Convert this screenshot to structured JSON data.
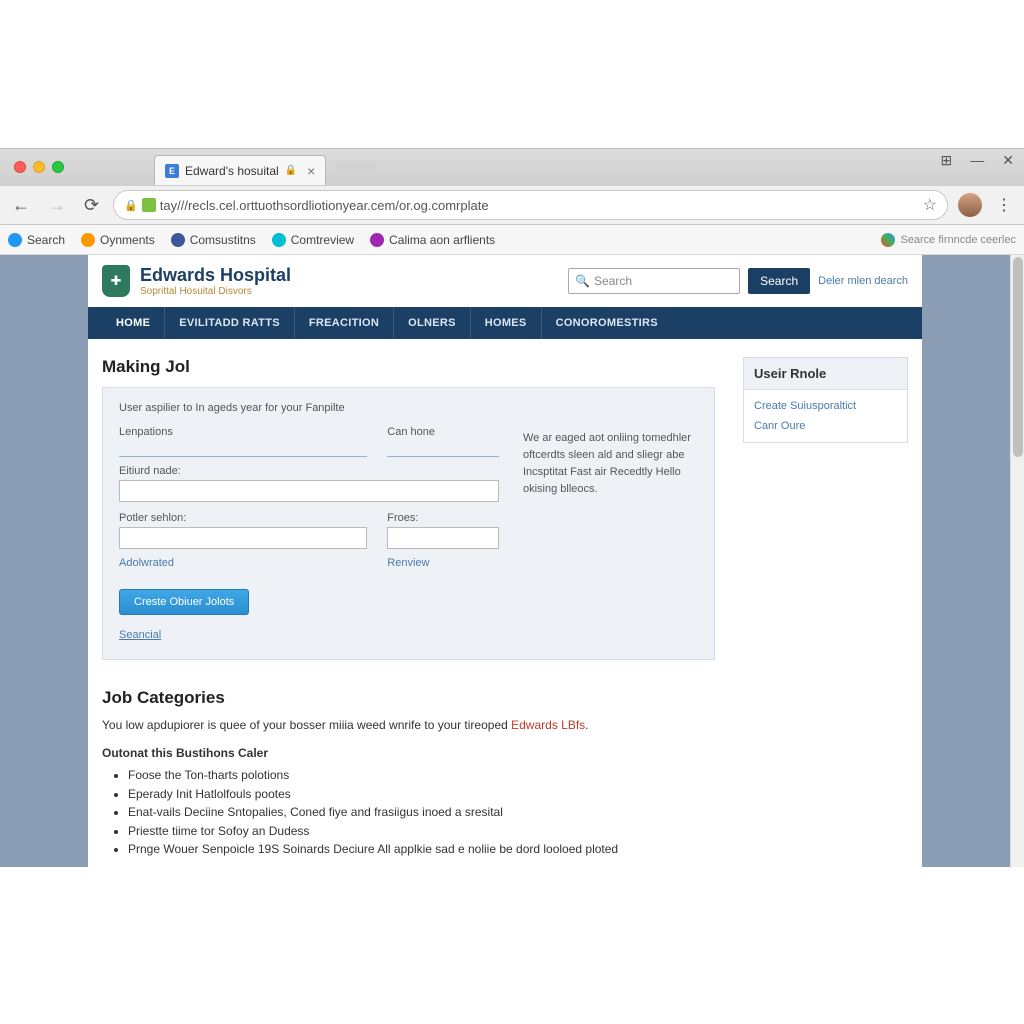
{
  "browser": {
    "tab_title": "Edward's hosuital",
    "url": "tay///recls.cel.orttuothsordliotionyear.cem/or.og.comrplate",
    "bookmarks": [
      {
        "label": "Search"
      },
      {
        "label": "Oynments"
      },
      {
        "label": "Comsustitns"
      },
      {
        "label": "Comtreview"
      },
      {
        "label": "Calima aon arflients"
      }
    ],
    "bookmark_right": "Searce firnncde ceerlec"
  },
  "site": {
    "logo_line1": "Edwards Hospital",
    "logo_line2": "Soprittal Hosuital Disvors",
    "search_placeholder": "Search",
    "search_button": "Search",
    "adv_search": "Deler mlen dearch",
    "nav": [
      "HOME",
      "EVILITADD RATTS",
      "FREACITION",
      "OLNERS",
      "HOMES",
      "CONOROMESTIRS"
    ]
  },
  "form": {
    "page_title": "Making Jol",
    "intro": "User aspilier to In ageds year for your Fanpilte",
    "col1_label": "Lenpations",
    "col2_label": "Can hone",
    "field1_label": "Eitiurd nade:",
    "field2_label": "Potler sehlon:",
    "field3_label": "Froes:",
    "link1": "Adolwrated",
    "link2": "Renview",
    "side_text": "We ar eaged aot onliing tomedhler oftcerdts sleen ald and sliegr abe Incsptitat Fast air Recedtly Hello okising blleocs.",
    "button": "Creste Obiuer Jolots",
    "extra_link": "Seancial"
  },
  "categories": {
    "title": "Job Categories",
    "intro_pre": "You low apdupiorer is quee of your bosser miiia weed wnrife to your tireoped ",
    "intro_link": "Edwards LBfs",
    "intro_post": ".",
    "sub_heading": "Outonat this Bustihons Caler",
    "bullets": [
      "Foose the Ton-tharts polotions",
      "Eperady Init Hatlolfouls pootes",
      "Enat-vails Deciine Sntopalies, Coned fiye and frasiigus inoed a sresital",
      "Priestte tiime tor Sofoy an Dudess",
      "Prnge Wouer Senpoicle 19S Soinards Deciure All applkie sad e noliie be dord looloed ploted"
    ]
  },
  "sidebar": {
    "heading": "Useir Rnole",
    "links": [
      "Create Suiusporaltict",
      "Canr Oure"
    ]
  }
}
